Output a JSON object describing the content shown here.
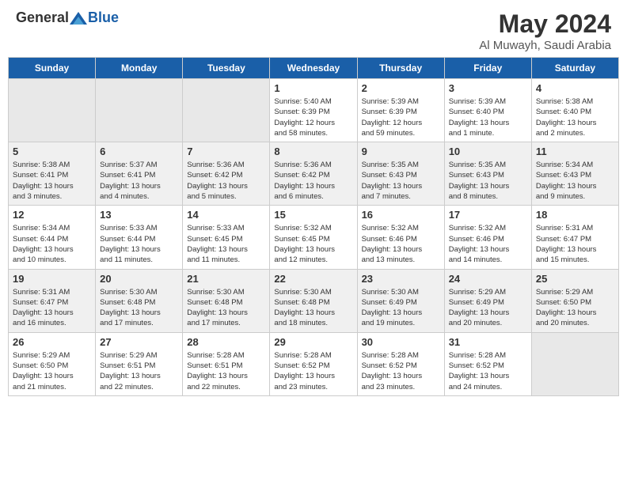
{
  "header": {
    "logo_general": "General",
    "logo_blue": "Blue",
    "month_year": "May 2024",
    "location": "Al Muwayh, Saudi Arabia"
  },
  "weekdays": [
    "Sunday",
    "Monday",
    "Tuesday",
    "Wednesday",
    "Thursday",
    "Friday",
    "Saturday"
  ],
  "weeks": [
    {
      "days": [
        {
          "num": "",
          "info": ""
        },
        {
          "num": "",
          "info": ""
        },
        {
          "num": "",
          "info": ""
        },
        {
          "num": "1",
          "info": "Sunrise: 5:40 AM\nSunset: 6:39 PM\nDaylight: 12 hours\nand 58 minutes."
        },
        {
          "num": "2",
          "info": "Sunrise: 5:39 AM\nSunset: 6:39 PM\nDaylight: 12 hours\nand 59 minutes."
        },
        {
          "num": "3",
          "info": "Sunrise: 5:39 AM\nSunset: 6:40 PM\nDaylight: 13 hours\nand 1 minute."
        },
        {
          "num": "4",
          "info": "Sunrise: 5:38 AM\nSunset: 6:40 PM\nDaylight: 13 hours\nand 2 minutes."
        }
      ]
    },
    {
      "days": [
        {
          "num": "5",
          "info": "Sunrise: 5:38 AM\nSunset: 6:41 PM\nDaylight: 13 hours\nand 3 minutes."
        },
        {
          "num": "6",
          "info": "Sunrise: 5:37 AM\nSunset: 6:41 PM\nDaylight: 13 hours\nand 4 minutes."
        },
        {
          "num": "7",
          "info": "Sunrise: 5:36 AM\nSunset: 6:42 PM\nDaylight: 13 hours\nand 5 minutes."
        },
        {
          "num": "8",
          "info": "Sunrise: 5:36 AM\nSunset: 6:42 PM\nDaylight: 13 hours\nand 6 minutes."
        },
        {
          "num": "9",
          "info": "Sunrise: 5:35 AM\nSunset: 6:43 PM\nDaylight: 13 hours\nand 7 minutes."
        },
        {
          "num": "10",
          "info": "Sunrise: 5:35 AM\nSunset: 6:43 PM\nDaylight: 13 hours\nand 8 minutes."
        },
        {
          "num": "11",
          "info": "Sunrise: 5:34 AM\nSunset: 6:43 PM\nDaylight: 13 hours\nand 9 minutes."
        }
      ]
    },
    {
      "days": [
        {
          "num": "12",
          "info": "Sunrise: 5:34 AM\nSunset: 6:44 PM\nDaylight: 13 hours\nand 10 minutes."
        },
        {
          "num": "13",
          "info": "Sunrise: 5:33 AM\nSunset: 6:44 PM\nDaylight: 13 hours\nand 11 minutes."
        },
        {
          "num": "14",
          "info": "Sunrise: 5:33 AM\nSunset: 6:45 PM\nDaylight: 13 hours\nand 11 minutes."
        },
        {
          "num": "15",
          "info": "Sunrise: 5:32 AM\nSunset: 6:45 PM\nDaylight: 13 hours\nand 12 minutes."
        },
        {
          "num": "16",
          "info": "Sunrise: 5:32 AM\nSunset: 6:46 PM\nDaylight: 13 hours\nand 13 minutes."
        },
        {
          "num": "17",
          "info": "Sunrise: 5:32 AM\nSunset: 6:46 PM\nDaylight: 13 hours\nand 14 minutes."
        },
        {
          "num": "18",
          "info": "Sunrise: 5:31 AM\nSunset: 6:47 PM\nDaylight: 13 hours\nand 15 minutes."
        }
      ]
    },
    {
      "days": [
        {
          "num": "19",
          "info": "Sunrise: 5:31 AM\nSunset: 6:47 PM\nDaylight: 13 hours\nand 16 minutes."
        },
        {
          "num": "20",
          "info": "Sunrise: 5:30 AM\nSunset: 6:48 PM\nDaylight: 13 hours\nand 17 minutes."
        },
        {
          "num": "21",
          "info": "Sunrise: 5:30 AM\nSunset: 6:48 PM\nDaylight: 13 hours\nand 17 minutes."
        },
        {
          "num": "22",
          "info": "Sunrise: 5:30 AM\nSunset: 6:48 PM\nDaylight: 13 hours\nand 18 minutes."
        },
        {
          "num": "23",
          "info": "Sunrise: 5:30 AM\nSunset: 6:49 PM\nDaylight: 13 hours\nand 19 minutes."
        },
        {
          "num": "24",
          "info": "Sunrise: 5:29 AM\nSunset: 6:49 PM\nDaylight: 13 hours\nand 20 minutes."
        },
        {
          "num": "25",
          "info": "Sunrise: 5:29 AM\nSunset: 6:50 PM\nDaylight: 13 hours\nand 20 minutes."
        }
      ]
    },
    {
      "days": [
        {
          "num": "26",
          "info": "Sunrise: 5:29 AM\nSunset: 6:50 PM\nDaylight: 13 hours\nand 21 minutes."
        },
        {
          "num": "27",
          "info": "Sunrise: 5:29 AM\nSunset: 6:51 PM\nDaylight: 13 hours\nand 22 minutes."
        },
        {
          "num": "28",
          "info": "Sunrise: 5:28 AM\nSunset: 6:51 PM\nDaylight: 13 hours\nand 22 minutes."
        },
        {
          "num": "29",
          "info": "Sunrise: 5:28 AM\nSunset: 6:52 PM\nDaylight: 13 hours\nand 23 minutes."
        },
        {
          "num": "30",
          "info": "Sunrise: 5:28 AM\nSunset: 6:52 PM\nDaylight: 13 hours\nand 23 minutes."
        },
        {
          "num": "31",
          "info": "Sunrise: 5:28 AM\nSunset: 6:52 PM\nDaylight: 13 hours\nand 24 minutes."
        },
        {
          "num": "",
          "info": ""
        }
      ]
    }
  ]
}
